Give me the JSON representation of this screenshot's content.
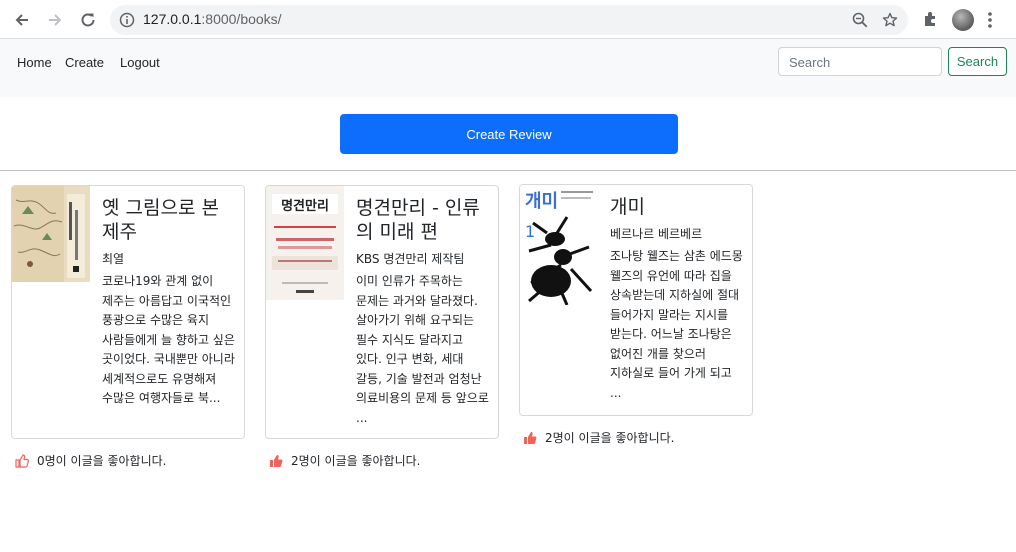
{
  "browser": {
    "url_host": "127.0.0.1",
    "url_path": ":8000/books/"
  },
  "navbar": {
    "links": [
      "Home",
      "Create",
      "Logout"
    ],
    "search_placeholder": "Search",
    "search_button": "Search"
  },
  "create_review_label": "Create Review",
  "cards": [
    {
      "title": "옛 그림으로 본 제주",
      "author": "최열",
      "excerpt": "코로나19와 관계 없이 제주는 아름답고 이국적인 풍광으로 수많은 육지 사람들에게 늘 향하고 싶은 곳이었다. 국내뿐만 아니라 세계적으로도 유명해져 수많은 여행자들로 북...",
      "likes_text": "0명이 이글을 좋아합니다.",
      "liked": false
    },
    {
      "title": "명견만리 - 인류의 미래 편",
      "author": "KBS 명견만리 제작팀",
      "excerpt": "이미 인류가 주목하는 문제는 과거와 달라졌다. 살아가기 위해 요구되는 필수 지식도 달라지고 있다. 인구 변화, 세대 갈등, 기술 발전과 엄청난 의료비용의 문제 등 앞으로 ...",
      "likes_text": "2명이 이글을 좋아합니다.",
      "liked": true
    },
    {
      "title": "개미",
      "author": "베르나르 베르베르",
      "excerpt": "조나탕 웰즈는 삼촌 에드몽 웰즈의 유언에 따라 집을 상속받는데 지하실에 절대 들어가지 말라는 지시를 받는다. 어느날 조나탕은 없어진 개를 찾으러 지하실로 들어 가게 되고 ...",
      "likes_text": "2명이 이글을 좋아합니다.",
      "liked": true
    }
  ],
  "colors": {
    "primary": "#0d6efd",
    "success": "#198754",
    "like": "#f0625a"
  }
}
